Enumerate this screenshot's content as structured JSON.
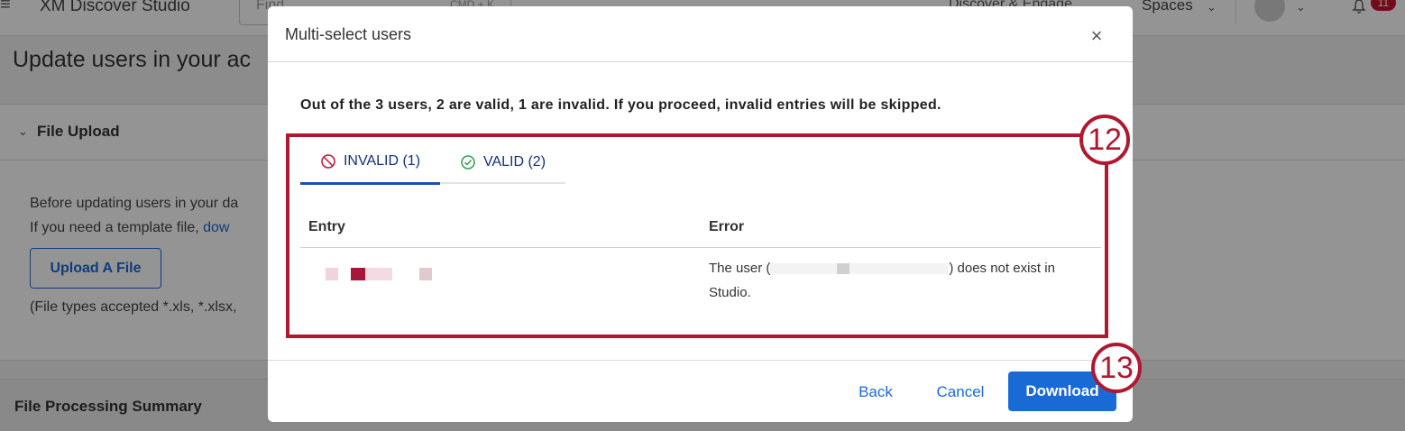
{
  "app": {
    "title": "XM Discover Studio",
    "search_placeholder": "Find",
    "search_shortcut": "CMD + K",
    "nav_discover": "Discover & Engage",
    "nav_spaces": "Spaces",
    "notification_count": "11"
  },
  "page": {
    "title": "Update users in your ac",
    "panel_title": "File Upload",
    "text_line1": "Before updating users in your da",
    "text_line2_prefix": "If you need a template file, ",
    "text_line2_link": "dow",
    "upload_button": "Upload A File",
    "text_line3": "(File types accepted *.xls, *.xlsx,",
    "summary_title": "File Processing Summary"
  },
  "modal": {
    "title": "Multi-select users",
    "summary": "Out of the 3 users, 2 are valid, 1 are invalid. If you proceed, invalid entries will be skipped.",
    "tabs": [
      {
        "label": "INVALID (1)",
        "icon": "prohibited-icon",
        "active": true
      },
      {
        "label": "VALID (2)",
        "icon": "check-circle-icon",
        "active": false
      }
    ],
    "columns": {
      "entry": "Entry",
      "error": "Error"
    },
    "row": {
      "error_prefix": "The user (",
      "error_suffix": ") does not exist in",
      "error_line2": "Studio."
    },
    "buttons": {
      "back": "Back",
      "cancel": "Cancel",
      "download": "Download"
    }
  },
  "callouts": {
    "first": "12",
    "second": "13"
  },
  "colors": {
    "accent": "#1a6ad6",
    "callout": "#b01830",
    "tab_text": "#12307a",
    "danger": "#c8102e"
  }
}
